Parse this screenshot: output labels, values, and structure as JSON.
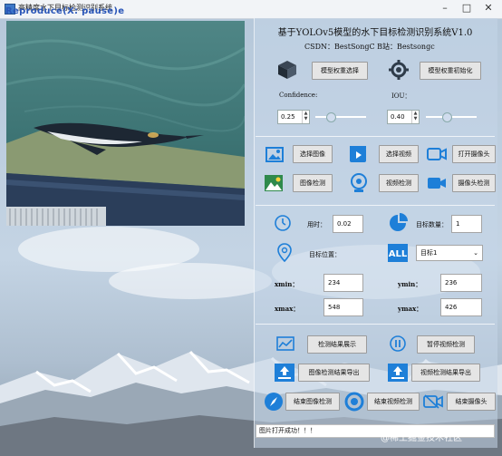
{
  "window": {
    "title": "高精度水下目标检测识别系统",
    "overlay": "Reproduce(X: pause)e",
    "minimize": "–",
    "maximize": "□",
    "close": "✕"
  },
  "header": {
    "title": "基于YOLOv5模型的水下目标检测识别系统V1.0",
    "credits": "CSDN：BestSongC    B站：Bestsongc"
  },
  "model": {
    "select_label": "模型权重选择",
    "init_label": "模型权重初始化",
    "confidence_label": "Confidence:",
    "confidence_value": "0.25",
    "confidence_level": 0.25,
    "iou_label": "IOU：",
    "iou_value": "0.40",
    "iou_level": 0.4
  },
  "media": {
    "select_image": "选择图像",
    "select_video": "选择视频",
    "open_camera": "打开摄像头",
    "image_detect": "图像检测",
    "video_detect": "视频检测",
    "camera_detect": "摄像头检测"
  },
  "results": {
    "time_label": "用时：",
    "time_value": "0.02",
    "count_label": "目标数量：",
    "count_value": "1",
    "position_label": "目标位置：",
    "target_selected": "目标1",
    "xmin_label": "xmin：",
    "xmin_value": "234",
    "ymin_label": "ymin：",
    "ymin_value": "236",
    "xmax_label": "xmax：",
    "xmax_value": "548",
    "ymax_label": "ymax：",
    "ymax_value": "426"
  },
  "actions": {
    "show_results": "检测结果展示",
    "pause_video": "暂停视频检测",
    "export_image": "图像检测结果导出",
    "export_video": "视频检测结果导出",
    "end_image": "结束图像检测",
    "end_video": "结束视频检测",
    "end_camera": "结束摄像头"
  },
  "status": {
    "message": "图片打开成功！！！"
  },
  "watermark": "@稀土掘金技术社区",
  "colors": {
    "accent_blue": "#1e7fd8",
    "icon_dark": "#2f3c4a",
    "panel_bg": "#c4d6e8"
  }
}
